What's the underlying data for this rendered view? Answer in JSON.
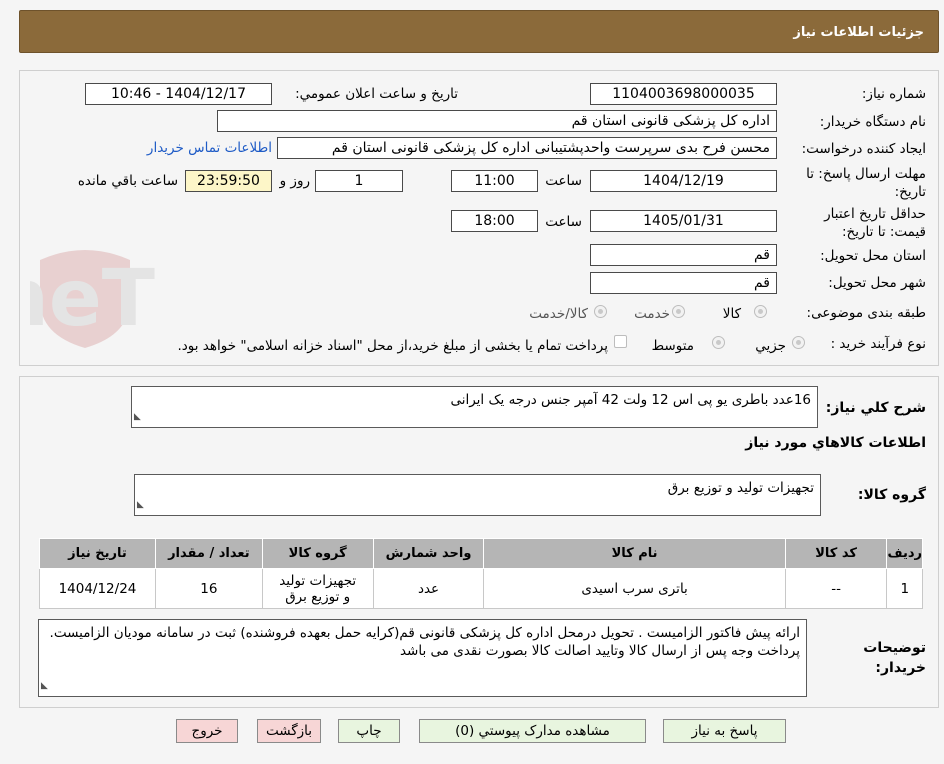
{
  "header": {
    "title": "جزئيات اطلاعات نياز"
  },
  "form": {
    "need_number": {
      "label": "شماره نياز:",
      "value": "1104003698000035"
    },
    "announce": {
      "label": "تاريخ و ساعت اعلان عمومي:",
      "value": "1404/12/17 - 10:46"
    },
    "buyer_org": {
      "label": "نام دستگاه خريدار:",
      "value": "اداره کل پزشکی قانونی استان قم"
    },
    "requester": {
      "label": "ايجاد کننده درخواست:",
      "value": "محسن فرح بدی سرپرست واحدپشتیبانی اداره کل پزشکی قانونی استان قم",
      "contact_link": "اطلاعات تماس خريدار"
    },
    "reply_deadline": {
      "label_line1": "مهلت ارسال پاسخ: تا",
      "label_line2": "تاريخ:",
      "date": "1404/12/19",
      "time_label": "ساعت",
      "time": "11:00",
      "days": "1",
      "days_label": "روز و",
      "remaining": "23:59:50",
      "remaining_label": "ساعت باقي مانده"
    },
    "price_validity": {
      "label_line1": "حداقل تاريخ اعتبار",
      "label_line2": "قيمت: تا تاريخ:",
      "date": "1405/01/31",
      "time_label": "ساعت",
      "time": "18:00"
    },
    "province": {
      "label": "استان محل تحويل:",
      "value": "قم"
    },
    "city": {
      "label": "شهر محل تحويل:",
      "value": "قم"
    },
    "category": {
      "label": "طبقه بندی موضوعی:",
      "options": [
        "کالا",
        "خدمت",
        "کالا/خدمت"
      ]
    },
    "purchase_process": {
      "label": "نوع فرآيند خريد :",
      "options": [
        "جزيي",
        "متوسط"
      ],
      "note": "پرداخت تمام يا بخشی از مبلغ خريد،از محل \"اسناد خزانه اسلامی\" خواهد بود."
    }
  },
  "description": {
    "label": "شرح کلي نياز:",
    "value": "16عدد باطری یو پی اس 12 ولت  42 آمپر جنس درجه یک ایرانی"
  },
  "items_section": {
    "title": "اطلاعات کالاهاي مورد نياز",
    "group_label": "گروه کالا:",
    "group_value": "تجهيزات توليد و توزيع برق",
    "columns": [
      "رديف",
      "کد کالا",
      "نام کالا",
      "واحد شمارش",
      "گروه کالا",
      "تعداد / مقدار",
      "تاريخ نياز"
    ],
    "rows": [
      [
        "1",
        "--",
        "باتری سرب اسیدی",
        "عدد",
        "تجهيزات توليد و توزيع برق",
        "16",
        "1404/12/24"
      ]
    ]
  },
  "buyer_notes": {
    "label_line1": "توضيحات",
    "label_line2": "خريدار:",
    "value": "ارائه پیش فاکتور الزامیست . تحویل درمحل اداره کل پزشکی قانونی قم(کرایه حمل بعهده فروشنده) ثبت در سامانه مودیان الزامیست. پرداخت وجه پس از ارسال کالا وتایید اصالت کالا بصورت نقدی می باشد"
  },
  "buttons": {
    "reply": "پاسخ به نياز",
    "attachments": "مشاهده مدارک پيوستي (0)",
    "print": "چاپ",
    "back": "بازگشت",
    "exit": "خروج"
  },
  "watermark": {
    "text": "AriaTender.neT"
  },
  "colors": {
    "header_bg": "#8b6a3a",
    "link": "#1e5bc6",
    "remaining_bg": "#fdf6c8",
    "table_header": "#b5b5b5",
    "btn_green": "#e8f5df",
    "btn_pink": "#f7d6d6"
  }
}
